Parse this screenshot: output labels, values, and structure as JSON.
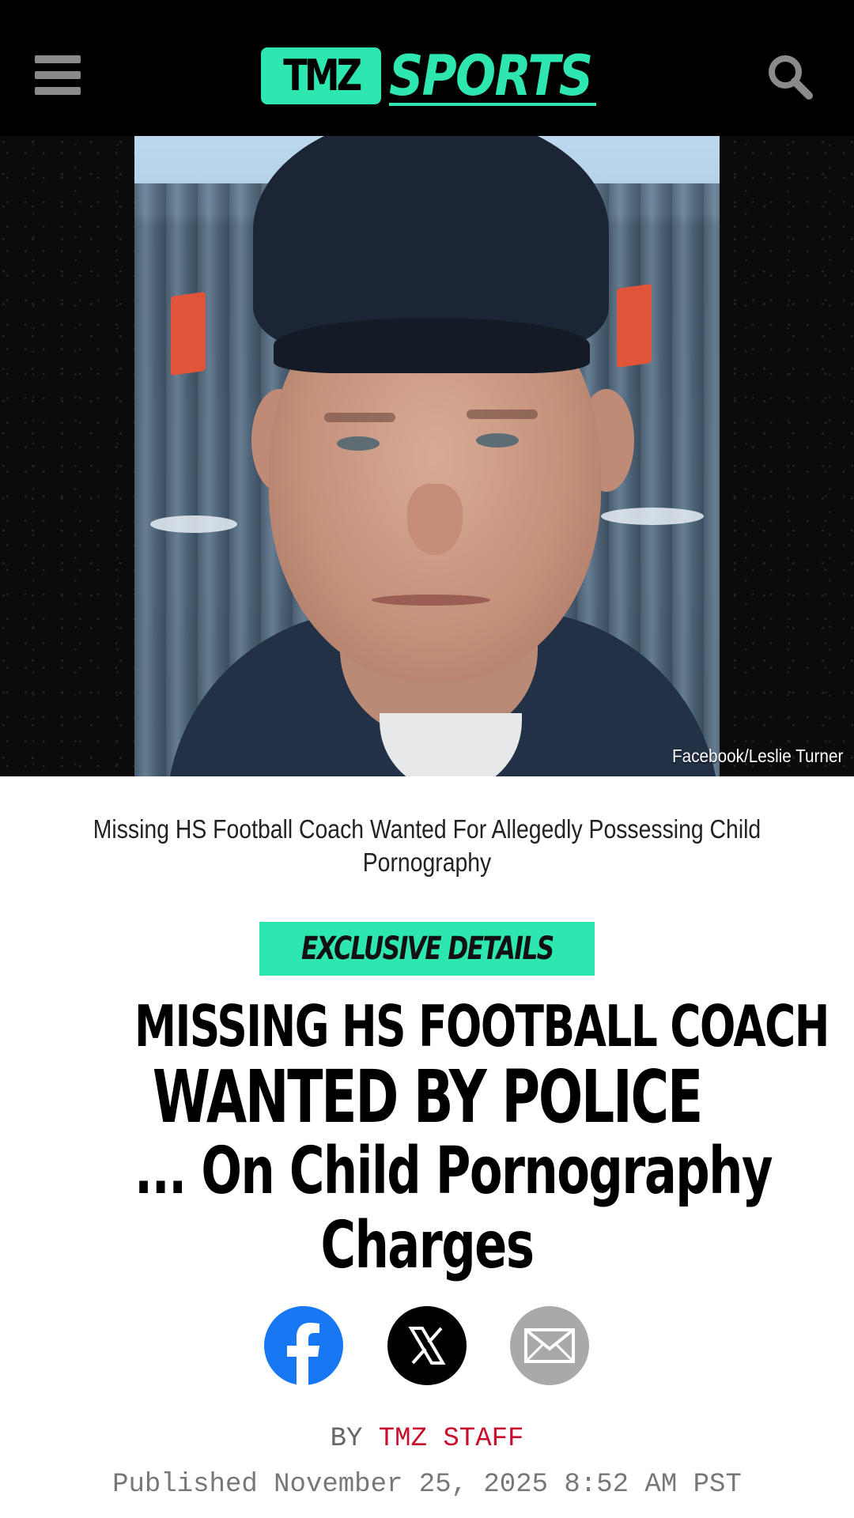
{
  "header": {
    "menu_icon": "hamburger-menu-icon",
    "logo": {
      "left": "TMZ",
      "right": "SPORTS"
    },
    "search_icon": "search-icon",
    "colors": {
      "background": "#000000",
      "brand_green": "#2ee6b0",
      "icon_gray": "#8a8a8a"
    }
  },
  "hero": {
    "photo_credit": "Facebook/Leslie Turner"
  },
  "caption": "Missing HS Football Coach Wanted For Allegedly Possessing Child Pornography",
  "badge": {
    "label": "EXCLUSIVE DETAILS"
  },
  "headline": {
    "line1": "MISSING HS FOOTBALL COACH",
    "line2": "WANTED BY POLICE",
    "line3": "... On Child Pornography",
    "line4": "Charges"
  },
  "share": [
    {
      "name": "facebook",
      "icon": "facebook-icon",
      "color": "#1877f2"
    },
    {
      "name": "x",
      "icon": "x-icon",
      "color": "#000000"
    },
    {
      "name": "email",
      "icon": "mail-icon",
      "color": "#a9a9a9"
    }
  ],
  "byline": {
    "by_label": "BY",
    "author": "TMZ STAFF",
    "published": "Published November 25, 2025 8:52 AM PST"
  },
  "colors": {
    "author_red": "#c8102e"
  }
}
